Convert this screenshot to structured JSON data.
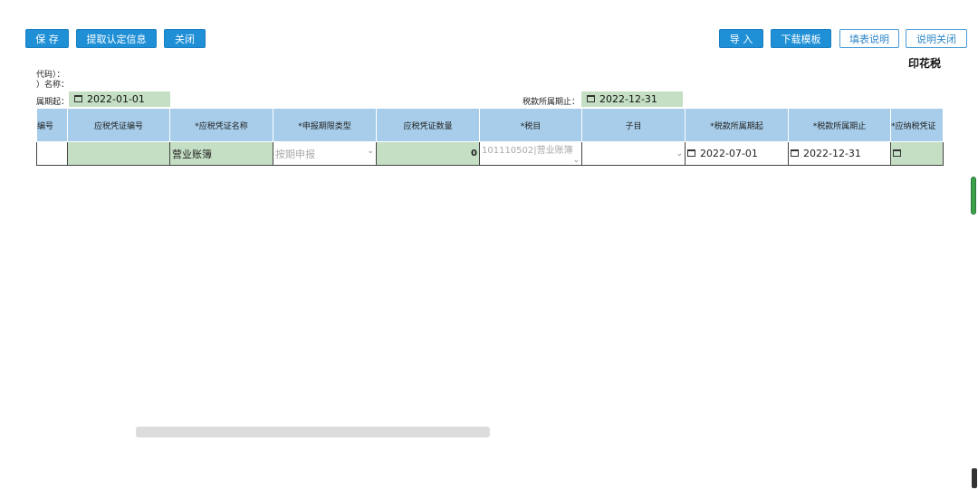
{
  "toolbar": {
    "save": "保 存",
    "fetch_info": "提取认定信息",
    "close": "关闭",
    "import": "导 入",
    "download_template": "下载模板",
    "fill_instructions": "填表说明",
    "close_instructions": "说明关闭"
  },
  "page_title": "印花税",
  "info": {
    "code_label": "代码）：",
    "name_label": "）名称：",
    "period_start_label": "属期起：",
    "period_start": "2022-01-01",
    "period_end_label": "税款所属期止：",
    "period_end": "2022-12-31"
  },
  "table": {
    "headers": [
      "编号",
      "应税凭证编号",
      "*应税凭证名称",
      "*申报期限类型",
      "应税凭证数量",
      "*税目",
      "子目",
      "*税款所属期起",
      "*税款所属期止",
      "*应纳税凭证"
    ],
    "row": {
      "no": "",
      "voucher_no": "",
      "voucher_name": "营业账簿",
      "period_type": "按期申报",
      "quantity": "0",
      "tax_item": "101110502|营业账簿",
      "sub_item": "",
      "start": "2022-07-01",
      "end": "2022-12-31",
      "last": ""
    }
  },
  "colors": {
    "primary": "#1f8fd6",
    "header_bg": "#a7cdea",
    "green_cell": "#c5dfc4"
  }
}
